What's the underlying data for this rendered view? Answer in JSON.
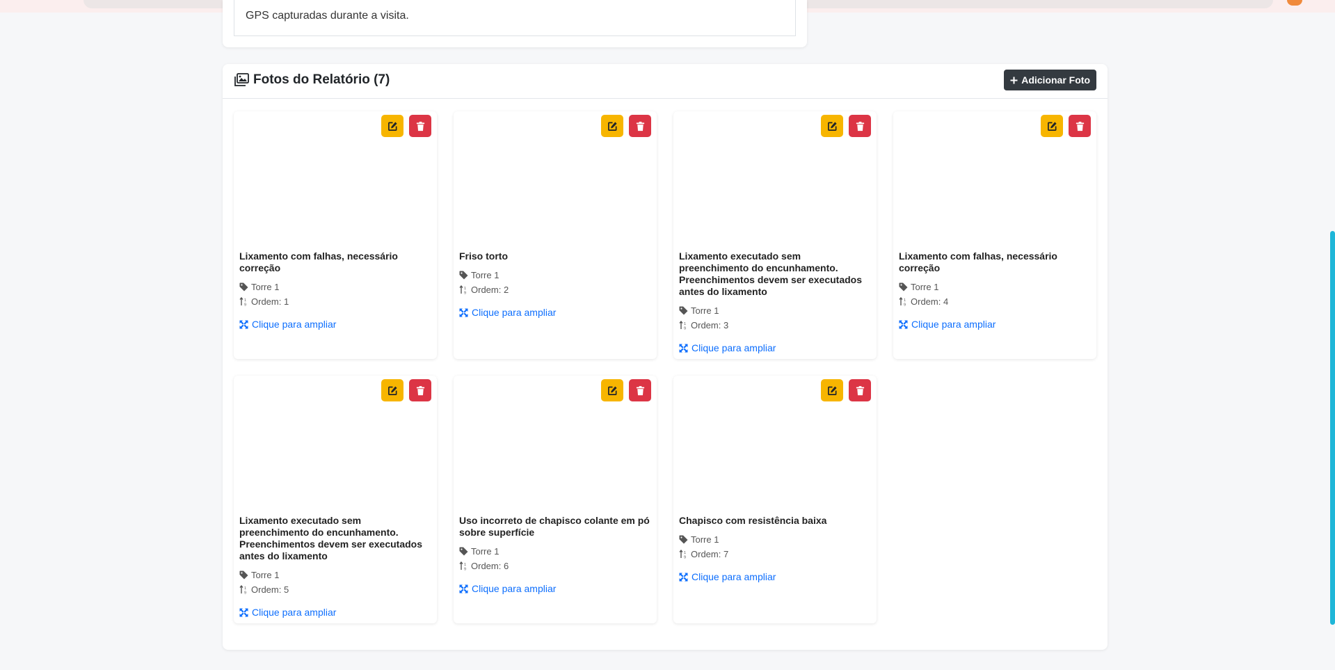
{
  "previous_section": {
    "text": "GPS capturadas durante a visita."
  },
  "photos_section": {
    "title": "Fotos do Relatório (7)",
    "add_button_label": "Adicionar Foto",
    "icons": {
      "title": "images-icon",
      "add": "plus-icon",
      "edit": "edit-icon",
      "delete": "trash-icon",
      "tag": "tag-icon",
      "order": "sort-order-icon",
      "expand": "expand-icon"
    },
    "colors": {
      "edit_button": "#f7b500",
      "delete_button": "#dc3545",
      "link": "#0d6efd",
      "add_button": "#343a40"
    },
    "photos": [
      {
        "description": "Lixamento com falhas, necessário correção",
        "location": "Torre 1",
        "order": "Ordem: 1",
        "link": "Clique para ampliar"
      },
      {
        "description": "Friso torto",
        "location": "Torre 1",
        "order": "Ordem: 2",
        "link": "Clique para ampliar"
      },
      {
        "description": "Lixamento executado sem preenchimento do encunhamento. Preenchimentos devem ser executados antes do lixamento",
        "location": "Torre 1",
        "order": "Ordem: 3",
        "link": "Clique para ampliar"
      },
      {
        "description": "Lixamento com falhas, necessário correção",
        "location": "Torre 1",
        "order": "Ordem: 4",
        "link": "Clique para ampliar"
      },
      {
        "description": "Lixamento executado sem preenchimento do encunhamento. Preenchimentos devem ser executados antes do lixamento",
        "location": "Torre 1",
        "order": "Ordem: 5",
        "link": "Clique para ampliar"
      },
      {
        "description": "Uso incorreto de chapisco colante em pó sobre superfície",
        "location": "Torre 1",
        "order": "Ordem: 6",
        "link": "Clique para ampliar"
      },
      {
        "description": "Chapisco com resistência baixa",
        "location": "Torre 1",
        "order": "Ordem: 7",
        "link": "Clique para ampliar"
      }
    ]
  }
}
